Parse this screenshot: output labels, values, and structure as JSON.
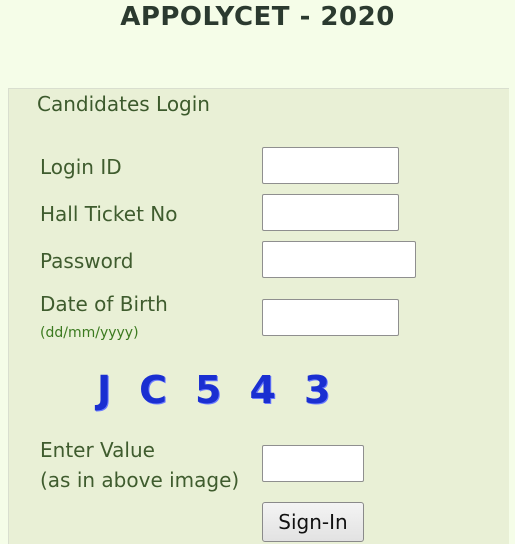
{
  "page": {
    "title": "APPOLYCET - 2020"
  },
  "login": {
    "legend": "Candidates Login",
    "login_id_label": "Login ID",
    "login_id_value": "",
    "hall_ticket_label": "Hall Ticket No",
    "hall_ticket_value": "",
    "password_label": "Password",
    "password_value": "",
    "dob_label": "Date of Birth",
    "dob_hint": "(dd/mm/yyyy)",
    "dob_value": "",
    "captcha_chars": [
      "J",
      "C",
      "5",
      "4",
      "3"
    ],
    "enter_value_label": "Enter Value",
    "enter_value_hint": "(as in above image)",
    "captcha_value": "",
    "signin_label": "Sign-In"
  },
  "colors": {
    "background": "#f5fde8",
    "panel": "#e9f0d6",
    "label_text": "#3f5c2e",
    "hint_text": "#3b7a1f",
    "captcha": "#1a2fd1"
  }
}
